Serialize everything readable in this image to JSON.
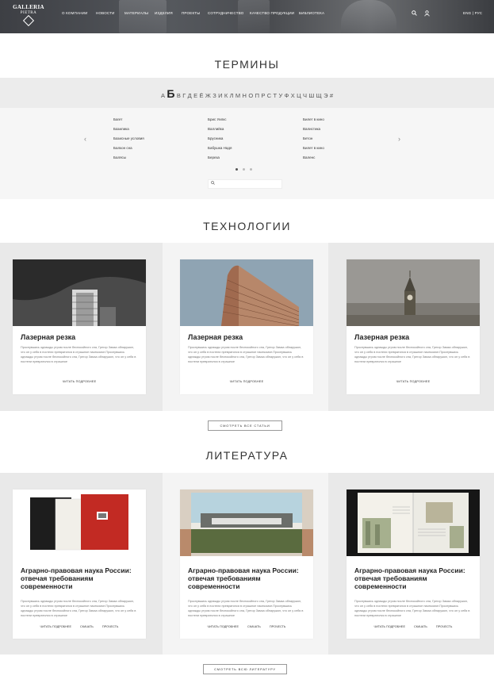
{
  "header": {
    "logo_line1": "GALLERIA",
    "logo_line2": "PIETRA",
    "nav": [
      "О КОМПАНИИ",
      "НОВОСТИ",
      "МАТЕРИАЛЫ",
      "ИЗДЕЛИЯ",
      "ПРОЕКТЫ",
      "СОТРУДНИЧЕСТВО",
      "КАЧЕСТВО ПРОДУКЦИИ",
      "БИБЛИОТЕКА"
    ],
    "lang_en": "ENG",
    "lang_sep": "|",
    "lang_ru": "РУС"
  },
  "terms": {
    "title": "ТЕРМИНЫ",
    "letters": [
      "А",
      "Б",
      "В",
      "Г",
      "Д",
      "Е",
      "Ё",
      "Ж",
      "З",
      "И",
      "К",
      "Л",
      "М",
      "Н",
      "О",
      "П",
      "Р",
      "С",
      "Т",
      "У",
      "Ф",
      "Х",
      "Ц",
      "Ч",
      "Ш",
      "Щ",
      "Э",
      "#"
    ],
    "active_letter": "Б",
    "col1": [
      "Багет",
      "Базилика",
      "Базисные условия",
      "Балкон сна",
      "Балясы"
    ],
    "col2": [
      "Брис Уилкс",
      "Валлийка",
      "Брусника",
      "Бабушка Надя",
      "Береза"
    ],
    "col3": [
      "Билет в кино",
      "Валистика",
      "Бетон",
      "Билет в кино",
      "Валенс"
    ]
  },
  "technologies": {
    "title": "ТЕХНОЛОГИИ",
    "cards": [
      {
        "title": "Лазерная резка",
        "text": "Проснувшись однажды утром после беспокойного сна, Грегор Замза обнаружил, что он у себя в постели превратился в страшное насекомое.Проснувшись однажды утром после беспокойного сна, Грегор Замза обнаружил, что он у себя в постели превратился в страшное",
        "more": "ЧИТАТЬ ПОДРОБНЕЕ"
      },
      {
        "title": "Лазерная резка",
        "text": "Проснувшись однажды утром после беспокойного сна, Грегор Замза обнаружил, что он у себя в постели превратился в страшное насекомое.Проснувшись однажды утром после беспокойного сна, Грегор Замза обнаружил, что он у себя в постели превратился в страшное",
        "more": "ЧИТАТЬ ПОДРОБНЕЕ"
      },
      {
        "title": "Лазерная резка",
        "text": "Проснувшись однажды утром после беспокойного сна, Грегор Замза обнаружил, что он у себя в постели превратился в страшное насекомое.Проснувшись однажды утром после беспокойного сна, Грегор Замза обнаружил, что он у себя в постели превратился в страшное",
        "more": "ЧИТАТЬ ПОДРОБНЕЕ"
      }
    ],
    "all_button": "СМОТРЕТЬ ВСЕ СТАТЬИ"
  },
  "literature": {
    "title": "ЛИТЕРАТУРА",
    "cards": [
      {
        "title": "Аграрно-правовая наука России: отвечая требованиям современности",
        "text": "Проснувшись однажды утром после беспокойного сна, Грегор Замза обнаружил, что он у себя в постели превратился в страшное насекомое.Проснувшись однажды утром после беспокойного сна, Грегор Замза обнаружил, что он у себя в постели превратился в страшное",
        "read": "ЧИТАТЬ ПОДРОБНЕЕ",
        "download": "СКАЧАТЬ",
        "read_online": "ПРОЧЕСТЬ"
      },
      {
        "title": "Аграрно-правовая наука России: отвечая требованиям современности",
        "text": "Проснувшись однажды утром после беспокойного сна, Грегор Замза обнаружил, что он у себя в постели превратился в страшное насекомое.Проснувшись однажды утром после беспокойного сна, Грегор Замза обнаружил, что он у себя в постели превратился в страшное",
        "read": "ЧИТАТЬ ПОДРОБНЕЕ",
        "download": "СКАЧАТЬ",
        "read_online": "ПРОЧЕСТЬ"
      },
      {
        "title": "Аграрно-правовая наука России: отвечая требованиям современности",
        "text": "Проснувшись однажды утром после беспокойного сна, Грегор Замза обнаружил, что он у себя в постели превратился в страшное насекомое.Проснувшись однажды утром после беспокойного сна, Грегор Замза обнаружил, что он у себя в постели превратился в страшное",
        "read": "ЧИТАТЬ ПОДРОБНЕЕ",
        "download": "СКАЧАТЬ",
        "read_online": "ПРОЧЕСТЬ"
      }
    ],
    "all_button": "СМОТРЕТЬ ВСЮ ЛИТЕРАТУРУ"
  }
}
